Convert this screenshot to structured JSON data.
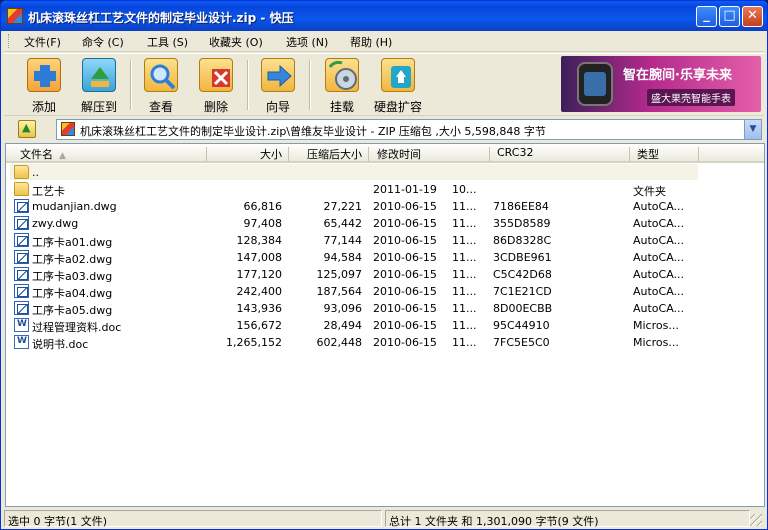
{
  "window": {
    "title": "机床滚珠丝杠工艺文件的制定毕业设计.zip - 快压",
    "minimize": "_",
    "maximize": "□",
    "close": "✕"
  },
  "menu": [
    "文件(F)",
    "命令 (C)",
    "工具 (S)",
    "收藏夹 (O)",
    "选项 (N)",
    "帮助 (H)"
  ],
  "toolbar": {
    "buttons": [
      {
        "label": "添加",
        "icon": "add-icon",
        "color": "#f3a23a"
      },
      {
        "label": "解压到",
        "icon": "extract-icon",
        "color": "#3aa5d8"
      },
      {
        "label": "查看",
        "icon": "view-icon",
        "color": "#2c7fd4"
      },
      {
        "label": "删除",
        "icon": "delete-icon",
        "color": "#d6392c"
      },
      {
        "label": "向导",
        "icon": "wizard-icon",
        "color": "#3886d8"
      },
      {
        "label": "挂载",
        "icon": "mount-icon",
        "color": "#2e9a4a"
      },
      {
        "label": "硬盘扩容",
        "icon": "disk-expand-icon",
        "color": "#23a7c9"
      }
    ],
    "ad": {
      "text1": "智在腕间·乐享未来",
      "text2": "盛大果壳智能手表"
    }
  },
  "address": {
    "path": "机床滚珠丝杠工艺文件的制定毕业设计.zip\\曾维友毕业设计 - ZIP 压缩包 ,大小 5,598,848 字节"
  },
  "columns": {
    "name": "文件名",
    "size": "大小",
    "packed": "压缩后大小",
    "modified": "修改时间",
    "crc": "CRC32",
    "type": "类型"
  },
  "files": [
    {
      "name": "..",
      "size": "",
      "packed": "",
      "date": "",
      "time": "",
      "crc": "",
      "type": "",
      "icon": "folder-up-icon"
    },
    {
      "name": "工艺卡",
      "size": "",
      "packed": "",
      "date": "2011-01-19",
      "time": "10...",
      "crc": "",
      "type": "文件夹",
      "icon": "folder-icon"
    },
    {
      "name": "mudanjian.dwg",
      "size": "66,816",
      "packed": "27,221",
      "date": "2010-06-15",
      "time": "11...",
      "crc": "7186EE84",
      "type": "AutoCA...",
      "icon": "dwg-file-icon"
    },
    {
      "name": "zwy.dwg",
      "size": "97,408",
      "packed": "65,442",
      "date": "2010-06-15",
      "time": "11...",
      "crc": "355D8589",
      "type": "AutoCA...",
      "icon": "dwg-file-icon"
    },
    {
      "name": "工序卡a01.dwg",
      "size": "128,384",
      "packed": "77,144",
      "date": "2010-06-15",
      "time": "11...",
      "crc": "86D8328C",
      "type": "AutoCA...",
      "icon": "dwg-file-icon"
    },
    {
      "name": "工序卡a02.dwg",
      "size": "147,008",
      "packed": "94,584",
      "date": "2010-06-15",
      "time": "11...",
      "crc": "3CDBE961",
      "type": "AutoCA...",
      "icon": "dwg-file-icon"
    },
    {
      "name": "工序卡a03.dwg",
      "size": "177,120",
      "packed": "125,097",
      "date": "2010-06-15",
      "time": "11...",
      "crc": "C5C42D68",
      "type": "AutoCA...",
      "icon": "dwg-file-icon"
    },
    {
      "name": "工序卡a04.dwg",
      "size": "242,400",
      "packed": "187,564",
      "date": "2010-06-15",
      "time": "11...",
      "crc": "7C1E21CD",
      "type": "AutoCA...",
      "icon": "dwg-file-icon"
    },
    {
      "name": "工序卡a05.dwg",
      "size": "143,936",
      "packed": "93,096",
      "date": "2010-06-15",
      "time": "11...",
      "crc": "8D00ECBB",
      "type": "AutoCA...",
      "icon": "dwg-file-icon"
    },
    {
      "name": "过程管理资料.doc",
      "size": "156,672",
      "packed": "28,494",
      "date": "2010-06-15",
      "time": "11...",
      "crc": "95C44910",
      "type": "Micros...",
      "icon": "doc-file-icon"
    },
    {
      "name": "说明书.doc",
      "size": "1,265,152",
      "packed": "602,448",
      "date": "2010-06-15",
      "time": "11...",
      "crc": "7FC5E5C0",
      "type": "Micros...",
      "icon": "doc-file-icon"
    }
  ],
  "status": {
    "selected": "选中  0 字节(1 文件)",
    "total": "总计 1 文件夹  和  1,301,090 字节(9 文件)"
  }
}
